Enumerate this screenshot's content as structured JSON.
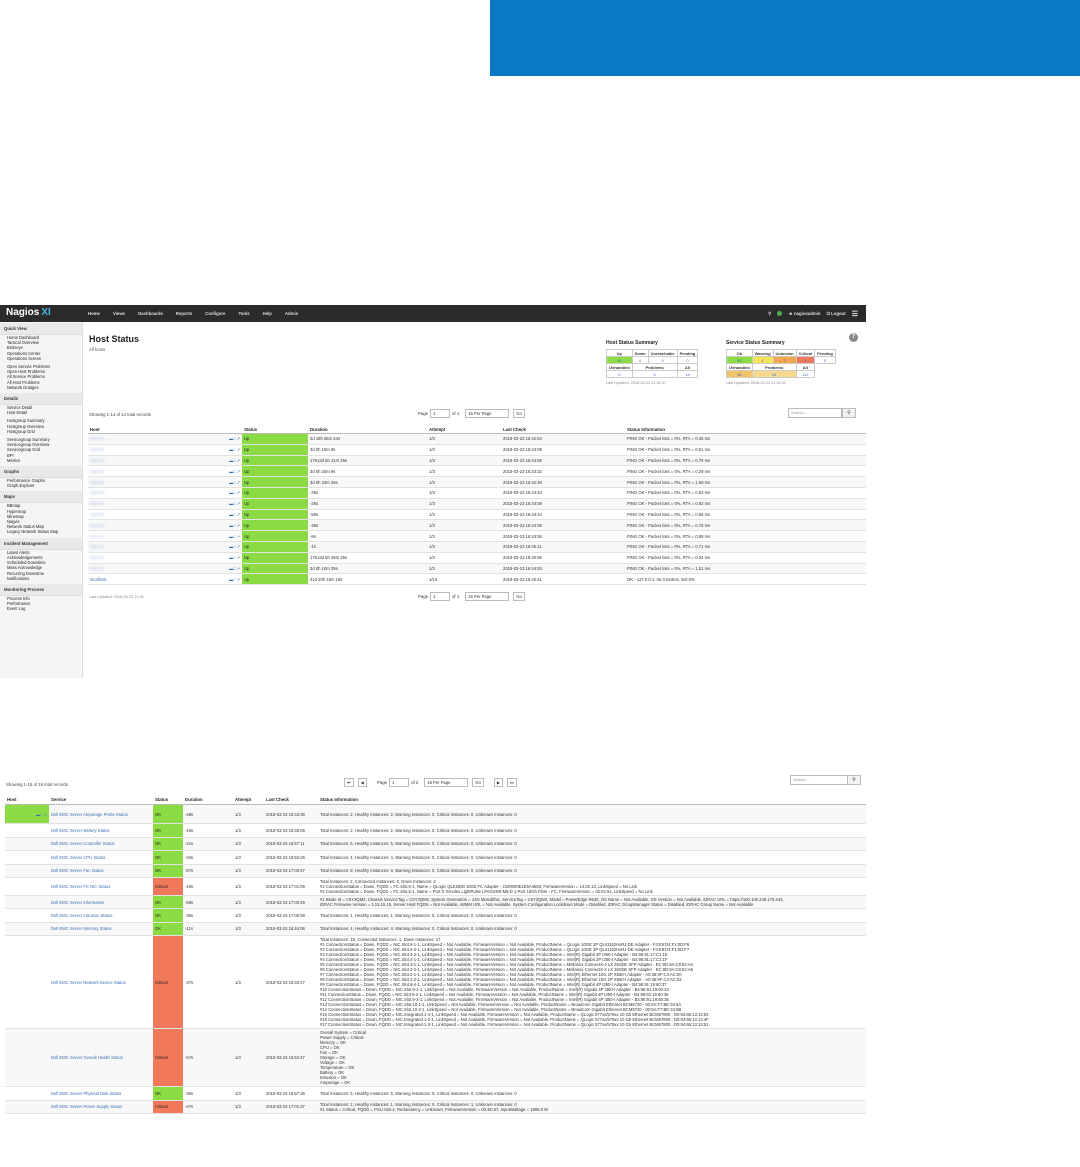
{
  "app": {
    "brand": "Nagios",
    "brand_suffix": "XI"
  },
  "nav": [
    "Home",
    "Views",
    "Dashboards",
    "Reports",
    "Configure",
    "Tools",
    "Help",
    "Admin"
  ],
  "topright": {
    "user": "nagiosadmin",
    "logout": "Logout"
  },
  "sidebar": [
    {
      "title": "Quick View",
      "items": [
        "Home Dashboard",
        "Tactical Overview",
        "Birdseye",
        "Operations Center",
        "Operations Screen",
        "",
        "Open Service Problems",
        "Open Host Problems",
        "All Service Problems",
        "All Host Problems",
        "Network Outages"
      ]
    },
    {
      "title": "Details",
      "items": [
        "Service Detail",
        "Host Detail",
        "",
        "Hostgroup Summary",
        "Hostgroup Overview",
        "Hostgroup Grid",
        "",
        "Servicegroup Summary",
        "Servicegroup Overview",
        "Servicegroup Grid",
        "BPI",
        "Metrics"
      ]
    },
    {
      "title": "Graphs",
      "items": [
        "Performance Graphs",
        "Graph Explorer"
      ]
    },
    {
      "title": "Maps",
      "items": [
        "BBmap",
        "Hypermap",
        "Minemap",
        "Nagvis",
        "Network Status Map",
        "Legacy Network Status Map"
      ]
    },
    {
      "title": "Incident Management",
      "items": [
        "Latest Alerts",
        "Acknowledgements",
        "Scheduled Downtime",
        "Mass Acknowledge",
        "Recurring Downtime",
        "Notifications"
      ]
    },
    {
      "title": "Monitoring Process",
      "items": [
        "Process Info",
        "Performance",
        "Event Log"
      ]
    }
  ],
  "page": {
    "title": "Host Status",
    "subtitle": "All hosts"
  },
  "host_summary": {
    "title": "Host Status Summary",
    "headers": [
      "Up",
      "Down",
      "Unreachable",
      "Pending"
    ],
    "values": [
      "14",
      "0",
      "0",
      "0"
    ],
    "headers2": [
      "Unhandled",
      "Problems",
      "All"
    ],
    "values2": [
      "0",
      "0",
      "14"
    ],
    "updated": "Last Updated: 2018-03-23 11:18:20"
  },
  "service_summary": {
    "title": "Service Status Summary",
    "headers": [
      "Ok",
      "Warning",
      "Unknown",
      "Critical",
      "Pending"
    ],
    "values": [
      "94",
      "2",
      "7",
      "9",
      "0"
    ],
    "headers2": [
      "Unhandled",
      "Problems",
      "All"
    ],
    "values2": [
      "18",
      "14",
      "112"
    ],
    "updated": "Last Updated: 2018-03-23 11:18:22"
  },
  "host_table": {
    "count": "Showing 1-14 of 14 total records",
    "page_label": "Page",
    "page_value": "1",
    "of_label": "of 1",
    "per_page": "15 Per Page",
    "go": "Go",
    "search": "Search...",
    "headers": [
      "Host",
      "Status",
      "Duration",
      "Attempt",
      "Last Check",
      "Status Information"
    ],
    "rows": [
      {
        "host": "host-01",
        "status": "Up",
        "duration": "2d 18h 56m 44s",
        "attempt": "1/3",
        "last": "2018-03-23 16:42:54",
        "info": "PING OK - Packet loss = 0%, RTA = 0.46 ms"
      },
      {
        "host": "host-02",
        "status": "Up",
        "duration": "3d 0h 15m 9s",
        "attempt": "1/3",
        "last": "2018-03-23 16:43:09",
        "info": "PING OK - Packet loss = 0%, RTA = 0.51 ms"
      },
      {
        "host": "host-03",
        "status": "Up",
        "duration": "17613d 5h 41m 25s",
        "attempt": "1/3",
        "last": "2018-03-23 16:44:59",
        "info": "PING OK - Packet loss = 0%, RTA = 0.76 ms"
      },
      {
        "host": "host-04",
        "status": "Up",
        "duration": "3d 0h 20m 9s",
        "attempt": "1/3",
        "last": "2018-03-23 16:43:32",
        "info": "PING OK - Packet loss = 0%, RTA = 0.29 ms"
      },
      {
        "host": "host-05",
        "status": "Up",
        "duration": "3d 0h 33m 39s",
        "attempt": "1/3",
        "last": "2018-03-23 16:42:49",
        "info": "PING OK - Packet loss = 0%, RTA = 1.59 ms"
      },
      {
        "host": "host-06",
        "status": "Up",
        "duration": "-35s",
        "attempt": "1/3",
        "last": "2018-03-23 16:43:43",
        "info": "PING OK - Packet loss = 0%, RTA = 0.83 ms"
      },
      {
        "host": "host-07",
        "status": "Up",
        "duration": "-25s",
        "attempt": "1/3",
        "last": "2018-03-23 16:44:09",
        "info": "PING OK - Packet loss = 0%, RTA = 0.63 ms"
      },
      {
        "host": "host-08",
        "status": "Up",
        "duration": "-50s",
        "attempt": "1/3",
        "last": "2018-03-23 16:44:44",
        "info": "PING OK - Packet loss = 0%, RTA = 0.56 ms"
      },
      {
        "host": "host-09",
        "status": "Up",
        "duration": "-35s",
        "attempt": "1/3",
        "last": "2018-03-23 16:44:59",
        "info": "PING OK - Packet loss = 0%, RTA = 0.76 ms"
      },
      {
        "host": "host-10",
        "status": "Up",
        "duration": "-8s",
        "attempt": "1/3",
        "last": "2018-03-23 16:43:56",
        "info": "PING OK - Packet loss = 0%, RTA = 0.89 ms"
      },
      {
        "host": "host-11",
        "status": "Up",
        "duration": "-1s",
        "attempt": "1/3",
        "last": "2018-03-23 16:45:11",
        "info": "PING OK - Packet loss = 0%, RTA = 0.71 ms"
      },
      {
        "host": "host-12",
        "status": "Up",
        "duration": "17613d 5h 45m 25s",
        "attempt": "1/3",
        "last": "2018-03-23 16:40:56",
        "info": "PING OK - Packet loss = 0%, RTA = 0.34 ms"
      },
      {
        "host": "host-13",
        "status": "Up",
        "duration": "3d 0h 10m 39s",
        "attempt": "1/3",
        "last": "2018-03-23 16:44:53",
        "info": "PING OK - Packet loss = 0%, RTA = 1.51 ms"
      },
      {
        "host": "localhost",
        "status": "Up",
        "duration": "41d 20h 16m 18s",
        "attempt": "1/10",
        "last": "2018-03-23 16:40:41",
        "info": "OK - 127.0.0.1: rta 0.043ms, lost 0%"
      }
    ],
    "updated": "Last Updated: 2018-03-23 11:18:"
  },
  "svc_table": {
    "count": "Showing 1-15 of 19 total records",
    "page_label": "Page",
    "page_value": "1",
    "of_label": "of 2",
    "per_page": "15 Per Page",
    "go": "Go",
    "search": "Search...",
    "headers": [
      "Host",
      "Service",
      "Status",
      "Duration",
      "Attempt",
      "Last Check",
      "Status Information"
    ],
    "rows": [
      {
        "service": "Dell EMC Server Amperage Probe Status",
        "status": "OK",
        "duration": "-48s",
        "attempt": "1/3",
        "last": "2018-03-23 16:43:38",
        "info": [
          "Total Instances: 2, Healthy Instances: 2, Warning Instances: 0, Critical Instances: 0, Unknown Instances: 0"
        ]
      },
      {
        "service": "Dell EMC Server Battery Status",
        "status": "OK",
        "duration": "-16s",
        "attempt": "1/3",
        "last": "2018-03-23 16:48:06",
        "info": [
          "Total Instances: 2, Healthy Instances: 2, Warning Instances: 0, Critical Instances: 0, Unknown Instances: 0"
        ]
      },
      {
        "service": "Dell EMC Server Controller Status",
        "status": "OK",
        "duration": "-21s",
        "attempt": "1/3",
        "last": "2018-03-23 16:57:11",
        "info": [
          "Total Instances: 5, Healthy Instances: 5, Warning Instances: 0, Critical Instances: 0, Unknown Instances: 0"
        ]
      },
      {
        "service": "Dell EMC Server CPU Status",
        "status": "OK",
        "duration": "-34s",
        "attempt": "1/3",
        "last": "2018-03-23 16:52:26",
        "info": [
          "Total Instances: 4, Healthy Instances: 4, Warning Instances: 0, Critical Instances: 0, Unknown Instances: 0"
        ]
      },
      {
        "service": "Dell EMC Server Fan Status",
        "status": "OK",
        "duration": "-57s",
        "attempt": "1/3",
        "last": "2018-03-23 17:00:47",
        "info": [
          "Total Instances: 8, Healthy Instances: 8, Warning Instances: 0, Critical Instances: 0, Unknown Instances: 0"
        ]
      },
      {
        "service": "Dell EMC Server FC NIC Status",
        "status": "Critical",
        "duration": "-19s",
        "attempt": "1/3",
        "last": "2018-03-23 17:01:09",
        "info": [
          "Total Instances: 2, Connected Instances: 0, Down Instances: 2",
          "#1 ConnectionStatus = Down, FQDD = FC.Slot.5-1, Name = QLogic QLE2690 16Gb FC Adapter - 2100000E1E6A4583, FirmwareVersion = 14.02.13, LinkSpeed = No Link",
          "#2 ConnectionStatus = Down, FQDD = FC.Slot.5-1, Name = Port 0: Emulex LightPulse LPe31000-M6-D 1-Port 16Gb Fibre - FC, FirmwareVersion = 02.02.91, LinkSpeed = No Link"
        ]
      },
      {
        "service": "Dell EMC Server Information",
        "status": "OK",
        "duration": "-59s",
        "attempt": "1/3",
        "last": "2018-03-23 17:00:49",
        "info": [
          "#1 Blade Id = C6Y3QM2, Chassis ServiceTag = C6Y3QM2, System Generation = 14G Monolithic, ServiceTag = C6Y3QM2, Model = PowerEdge R640, OS Name = Not Available, OS Version = Not Available, iDRAC URL = https://100.100.248.175:443,",
          "iDRAC Firmware Version = 3.15.15.15, Server Host FQDN = Not Available, iWMM URL = Not Available, System Configuration Lockdown Mode = Disabled, iDRAC GroupManager Status = Disabled, iDRAC Group Name = Not Available"
        ]
      },
      {
        "service": "Dell EMC Server Intrusion Status",
        "status": "OK",
        "duration": "-36s",
        "attempt": "1/3",
        "last": "2018-03-23 17:00:59",
        "info": [
          "Total Instances: 1, Healthy Instances: 1, Warning Instances: 0, Critical Instances: 0, Unknown Instances: 0"
        ]
      },
      {
        "service": "Dell EMC Server Memory Status",
        "status": "OK",
        "duration": "-11s",
        "attempt": "1/3",
        "last": "2018-03-23 16:44:06",
        "info": [
          "Total Instances: 4, Healthy Instances: 4, Warning Instances: 0, Critical Instances: 0, Unknown Instances: 0"
        ]
      },
      {
        "service": "Dell EMC Server Network Device Status",
        "status": "Critical",
        "duration": "-37s",
        "attempt": "1/3",
        "last": "2018-03-23 16:40:27",
        "info": [
          "Total Instances: 18, Connected Instances: 1, Down Instances: 17",
          "#1 ConnectionStatus = Down, FQDD = NIC.Slot.6-1-1, LinkSpeed = Not Available, FirmwareVersion = Not Available, ProductName = QLogic 10GE 2P QL41162HxRJ-DE Adapter - F4:E9:D4:F1:0D:F6",
          "#2 ConnectionStatus = Down, FQDD = NIC.Slot.6-2-1, LinkSpeed = Not Available, FirmwareVersion = Not Available, ProductName = QLogic 10GE 2P QL41162HxRJ-DE Adapter - F4:E9:D4:F1:0D:F7",
          "#3 ConnectionStatus = Down, FQDD = NIC.Slot.4-2-1, LinkSpeed = Not Available, FirmwareVersion = Not Available, ProductName = Intel(R) Gigabit 2P I350-t Adapter - B4:96:91:17:C1:1E",
          "#4 ConnectionStatus = Down, FQDD = NIC.Slot.4-1-1, LinkSpeed = Not Available, FirmwareVersion = Not Available, ProductName = Intel(R) Gigabit 2P I350-t Adapter - B4:96:91:17:C1:1F",
          "#5 ConnectionStatus = Down, FQDD = NIC.Slot.3-1-1, LinkSpeed = Not Available, FirmwareVersion = Not Available, ProductName = Mellanox ConnectX-4 LX 25GbE SFP Adapter - EC:0D:9A:C8:54:A4",
          "#6 ConnectionStatus = Down, FQDD = NIC.Slot.3-2-1, LinkSpeed = Not Available, FirmwareVersion = Not Available, ProductName = Mellanox ConnectX-4 LX 25GbE SFP Adapter - EC:0D:9A:C8:54:A5",
          "#7 ConnectionStatus = Down, FQDD = NIC.Slot.2-1-1, LinkSpeed = Not Available, FirmwareVersion = Not Available, ProductName = Intel(R) Ethernet 10G 2P X550-t Adapter - A0:36:9F:C4:AC:00",
          "#8 ConnectionStatus = Down, FQDD = NIC.Slot.2-2-1, LinkSpeed = Not Available, FirmwareVersion = Not Available, ProductName = Intel(R) Ethernet 10G 2P X550-t Adapter - A0:36:9F:C4:AC:02",
          "#9 ConnectionStatus = Down, FQDD = NIC.Slot.9-4-1, LinkSpeed = Not Available, FirmwareVersion = Not Available, ProductName = Intel(R) Gigabit 4P I350-t Adapter - B4:96:91:19:60:37",
          "#10 ConnectionStatus = Down, FQDD = NIC.Slot.9-1-1, LinkSpeed = Not Available, FirmwareVersion = Not Available, ProductName = Intel(R) Gigabit 4P I350-t Adapter - B4:96:91:19:60:34",
          "#11 ConnectionStatus = Down, FQDD = NIC.Slot.9-2-1, LinkSpeed = Not Available, FirmwareVersion = Not Available, ProductName = Intel(R) Gigabit 4P I350-t Adapter - B4:96:91:19:60:35",
          "#12 ConnectionStatus = Down, FQDD = NIC.Slot.9-3-1, LinkSpeed = Not Available, FirmwareVersion = Not Available, ProductName = Intel(R) Gigabit 4P I350-t Adapter - B4:96:91:19:60:36",
          "#13 ConnectionStatus = Down, FQDD = NIC.Slot.10-1-1, LinkSpeed = Not Available, FirmwareVersion = Not Available, ProductName = Broadcom Gigabit Ethernet BCM5720 - 00:0A:F7:BE:34:6A",
          "#14 ConnectionStatus = Down, FQDD = NIC.Slot.10-2-1, LinkSpeed = Not Available, FirmwareVersion = Not Available, ProductName = Broadcom Gigabit Ethernet BCM5720 - 00:0A:F7:BE:34:6B",
          "#15 ConnectionStatus = Down, FQDD = NIC.Integrated.1-4-1, LinkSpeed = Not Available, FirmwareVersion = Not Available, ProductName = QLogic 577xx/578xx 10 Gb Ethernet BCM57800 - D0:94:66:13:13:53",
          "#16 ConnectionStatus = Down, FQDD = NIC.Integrated.1-2-1, LinkSpeed = Not Available, FirmwareVersion = Not Available, ProductName = QLogic 577xx/578xx 10 Gb Ethernet BCM57800 - D0:94:66:13:13:4F",
          "#17 ConnectionStatus = Down, FQDD = NIC.Integrated.1-3-1, LinkSpeed = Not Available, FirmwareVersion = Not Available, ProductName = QLogic 577xx/578xx 10 Gb Ethernet BCM57800 - D0:94:66:13:13:51"
        ]
      },
      {
        "service": "Dell EMC Server Overall Health Status",
        "status": "Critical",
        "duration": "-57s",
        "attempt": "1/3",
        "last": "2018-03-23 16:52:47",
        "info": [
          "Overall System = Critical",
          "Power Supply = Critical",
          "Memory = OK",
          "CPU = OK",
          "Fan = OK",
          "Storage = OK",
          "Voltage = OK",
          "Temperature = OK",
          "Battery = OK",
          "Intrusion = OK",
          "Amperage = OK"
        ]
      },
      {
        "service": "Dell EMC Server Physical Disk Status",
        "status": "OK",
        "duration": "-36s",
        "attempt": "1/3",
        "last": "2018-03-23 16:57:26",
        "info": [
          "Total Instances: 5, Healthy Instances: 5, Warning Instances: 0, Critical Instances: 0, Unknown Instances: 0"
        ]
      },
      {
        "service": "Dell EMC Server Power Supply Status",
        "status": "Critical",
        "duration": "-47s",
        "attempt": "1/3",
        "last": "2018-03-23 17:01:37",
        "info": [
          "Total Instances: 2, Healthy Instances: 1, Warning Instances: 0, Critical Instances: 1, Unknown Instances: 0",
          "#1 Status = Critical, FQDD = PSU.Slot.2, Redundancy = Unknown, FirmwareVersion = 00.3D.67, InputWattage = 1908.0 W"
        ]
      }
    ]
  },
  "colors": {
    "ok": "#8bdc44",
    "critical": "#f2785c",
    "banner": "#0a78c2",
    "topbar": "#2b2b2b"
  }
}
